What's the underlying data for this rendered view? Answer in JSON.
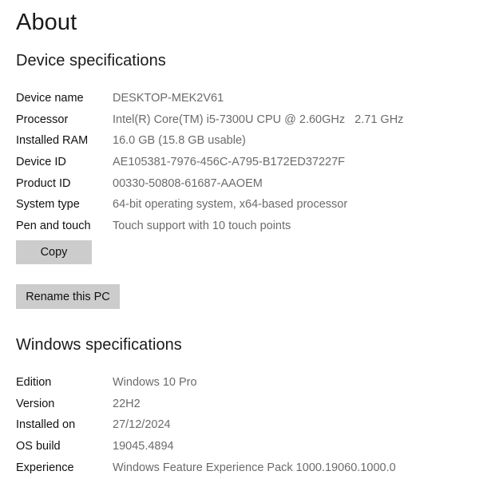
{
  "page": {
    "title": "About"
  },
  "device_section": {
    "heading": "Device specifications",
    "rows": [
      {
        "label": "Device name",
        "value": "DESKTOP-MEK2V61"
      },
      {
        "label": "Processor",
        "value": "Intel(R) Core(TM) i5-7300U CPU @ 2.60GHz   2.71 GHz"
      },
      {
        "label": "Installed RAM",
        "value": "16.0 GB (15.8 GB usable)"
      },
      {
        "label": "Device ID",
        "value": "AE105381-7976-456C-A795-B172ED37227F"
      },
      {
        "label": "Product ID",
        "value": "00330-50808-61687-AAOEM"
      },
      {
        "label": "System type",
        "value": "64-bit operating system, x64-based processor"
      },
      {
        "label": "Pen and touch",
        "value": "Touch support with 10 touch points"
      }
    ],
    "copy_button": "Copy",
    "rename_button": "Rename this PC"
  },
  "windows_section": {
    "heading": "Windows specifications",
    "rows": [
      {
        "label": "Edition",
        "value": "Windows 10 Pro"
      },
      {
        "label": "Version",
        "value": "22H2"
      },
      {
        "label": "Installed on",
        "value": "27/12/2024"
      },
      {
        "label": "OS build",
        "value": "19045.4894"
      },
      {
        "label": "Experience",
        "value": "Windows Feature Experience Pack 1000.19060.1000.0"
      }
    ]
  },
  "colors": {
    "background": "#ffffff",
    "label_text": "#111111",
    "value_text": "#6b6b6b",
    "button_fill": "#cccccc"
  }
}
